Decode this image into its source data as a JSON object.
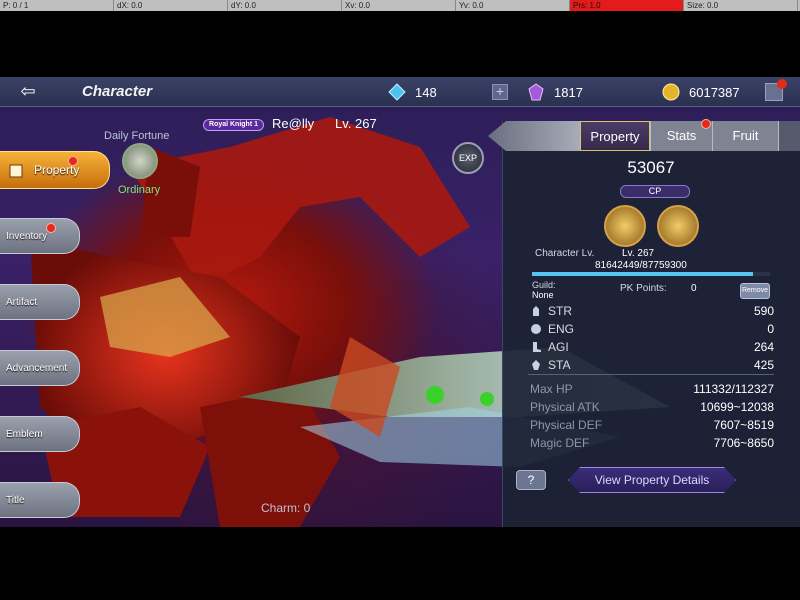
{
  "debug_bar": {
    "p": "P: 0 / 1",
    "dx": "dX: 0.0",
    "dy": "dY: 0.0",
    "xv": "Xv: 0.0",
    "yv": "Yv: 0.0",
    "prs": "Prs: 1.0",
    "size": "Size: 0.0"
  },
  "header": {
    "title": "Character",
    "diamonds": "148",
    "gems": "1817",
    "gold": "6017387"
  },
  "nav": {
    "items": [
      {
        "label": "Property",
        "active": true,
        "badge": true
      },
      {
        "label": "Inventory",
        "active": false,
        "badge": true
      },
      {
        "label": "Artifact",
        "active": false,
        "badge": false
      },
      {
        "label": "Advancement",
        "active": false,
        "badge": false
      },
      {
        "label": "Emblem",
        "active": false,
        "badge": false
      },
      {
        "label": "Title",
        "active": false,
        "badge": false
      }
    ]
  },
  "fortune": {
    "label": "Daily Fortune",
    "status": "Ordinary"
  },
  "player": {
    "rank": "Royal Knight 1",
    "name": "Re@lly",
    "level": "Lv. 267"
  },
  "exp_button": "EXP",
  "charm": "Charm:  0",
  "panel": {
    "tabs": [
      {
        "label": "Property",
        "active": true,
        "badge": false
      },
      {
        "label": "Stats",
        "active": false,
        "badge": true
      },
      {
        "label": "Fruit",
        "active": false,
        "badge": false
      }
    ],
    "cp_value": "53067",
    "cp_label": "CP",
    "char_lv_label": "Character Lv.",
    "char_lv_value": "Lv. 267",
    "exp_text": "81642449/87759300",
    "exp_fraction": 0.93,
    "guild_label": "Guild:",
    "guild_value": "None",
    "pk_label": "PK Points:",
    "pk_value": "0",
    "remove_label": "Remove",
    "stats": [
      {
        "name": "STR",
        "value": "590"
      },
      {
        "name": "ENG",
        "value": "0"
      },
      {
        "name": "AGI",
        "value": "264"
      },
      {
        "name": "STA",
        "value": "425"
      }
    ],
    "attributes": [
      {
        "name": "Max HP",
        "value": "111332/112327"
      },
      {
        "name": "Physical ATK",
        "value": "10699~12038"
      },
      {
        "name": "Physical DEF",
        "value": "7607~8519"
      },
      {
        "name": "Magic DEF",
        "value": "7706~8650"
      }
    ],
    "help_label": "?",
    "view_details_label": "View Property Details"
  }
}
